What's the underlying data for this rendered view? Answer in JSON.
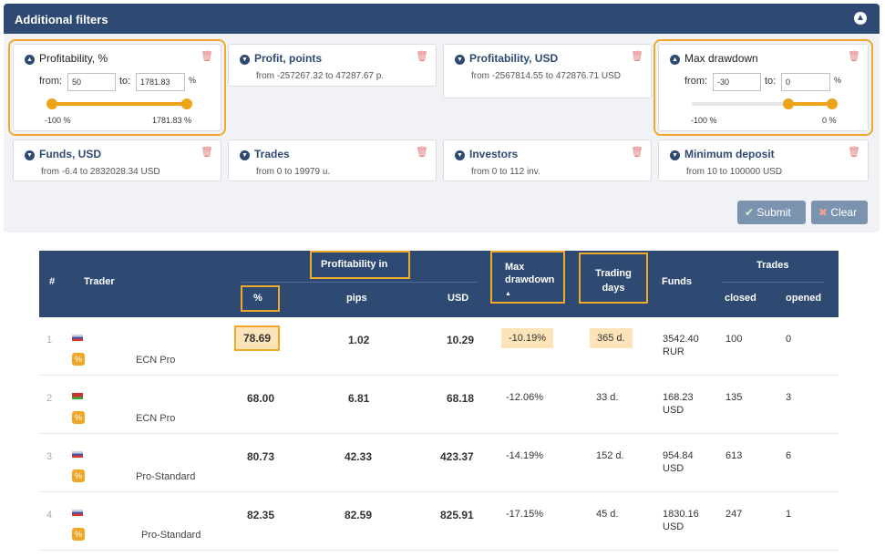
{
  "header": {
    "title": "Additional filters",
    "collapse_icon": "chevron-up-icon"
  },
  "filters": {
    "profitability_pct": {
      "title": "Profitability, %",
      "from_label": "from:",
      "from_value": "50",
      "to_label": "to:",
      "to_value": "1781.83",
      "unit": "%",
      "min_label": "-100 %",
      "max_label": "1781.83 %",
      "slider_low": 0.08,
      "slider_high": 1.0
    },
    "profit_points": {
      "title": "Profit, points",
      "range": "from -257267.32 to 47287.67 p."
    },
    "profitability_usd": {
      "title": "Profitability, USD",
      "range": "from -2567814.55 to 472876.71 USD"
    },
    "max_drawdown": {
      "title": "Max drawdown",
      "from_label": "from:",
      "from_value": "-30",
      "to_label": "to:",
      "to_value": "0",
      "unit": "%",
      "min_label": "-100 %",
      "max_label": "0 %",
      "slider_low": 0.7,
      "slider_high": 1.0
    },
    "funds_usd": {
      "title": "Funds, USD",
      "range": "from -6.4 to 2832028.34 USD"
    },
    "trades": {
      "title": "Trades",
      "range": "from 0 to 19979 u."
    },
    "investors": {
      "title": "Investors",
      "range": "from 0 to 112 inv."
    },
    "minimum_deposit": {
      "title": "Minimum deposit",
      "range": "from 10 to 100000 USD"
    }
  },
  "buttons": {
    "submit": "Submit",
    "clear": "Clear"
  },
  "table": {
    "headers": {
      "num": "#",
      "trader": "Trader",
      "profitability_in": "Profitability in",
      "pct": "%",
      "pips": "pips",
      "usd": "USD",
      "max_drawdown": "Max drawdown",
      "trading_days": "Trading days",
      "funds": "Funds",
      "trades": "Trades",
      "closed": "closed",
      "opened": "opened"
    },
    "rows": [
      {
        "num": "1",
        "account": "ECN Pro",
        "pct": "78.69",
        "pips": "1.02",
        "usd": "10.29",
        "drawdown": "-10.19%",
        "days": "365 d.",
        "funds": "3542.40",
        "currency": "RUR",
        "closed": "100",
        "opened": "0"
      },
      {
        "num": "2",
        "account": "ECN Pro",
        "pct": "68.00",
        "pips": "6.81",
        "usd": "68.18",
        "drawdown": "-12.06%",
        "days": "33 d.",
        "funds": "168.23",
        "currency": "USD",
        "closed": "135",
        "opened": "3"
      },
      {
        "num": "3",
        "account": "Pro-Standard",
        "pct": "80.73",
        "pips": "42.33",
        "usd": "423.37",
        "drawdown": "-14.19%",
        "days": "152 d.",
        "funds": "954.84",
        "currency": "USD",
        "closed": "613",
        "opened": "6"
      },
      {
        "num": "4",
        "account": "Pro-Standard",
        "pct": "82.35",
        "pips": "82.59",
        "usd": "825.91",
        "drawdown": "-17.15%",
        "days": "45 d.",
        "funds": "1830.16",
        "currency": "USD",
        "closed": "247",
        "opened": "1"
      }
    ]
  },
  "colors": {
    "accent": "#eda31a",
    "header": "#2e4a72",
    "highlight": "#f0a92a"
  }
}
